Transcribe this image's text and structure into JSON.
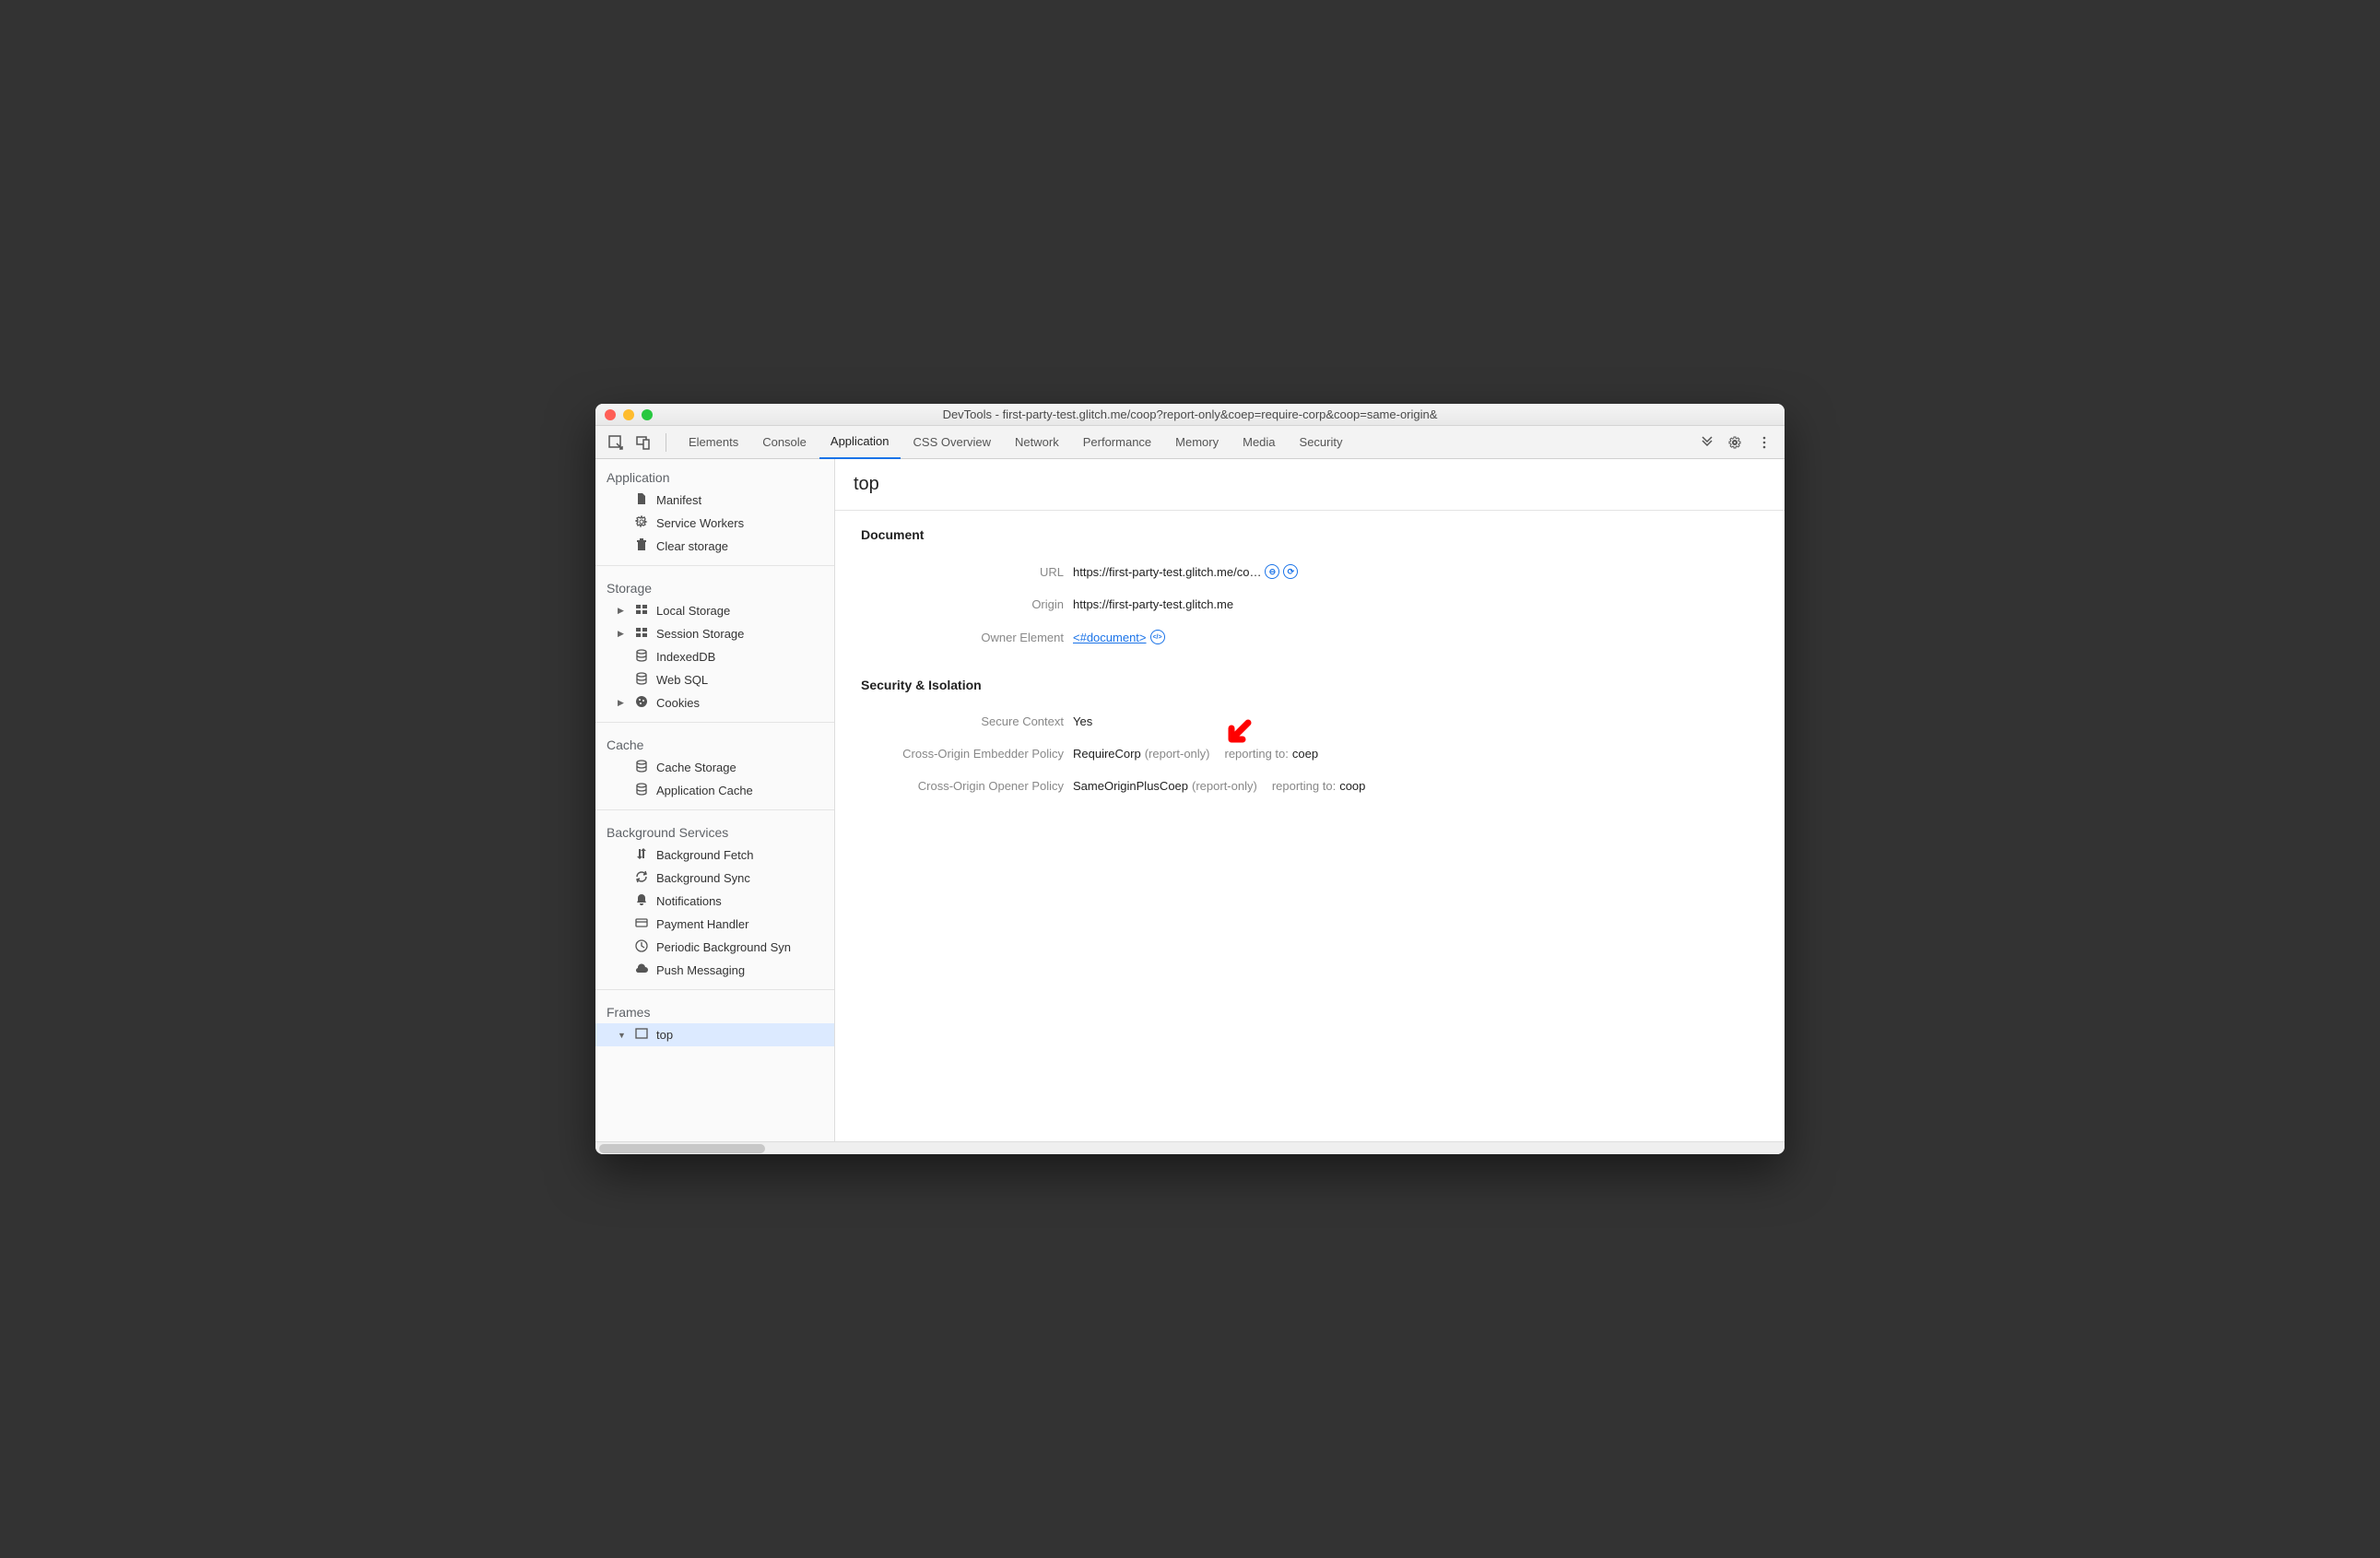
{
  "window": {
    "title": "DevTools - first-party-test.glitch.me/coop?report-only&coep=require-corp&coop=same-origin&"
  },
  "tabs": {
    "items": [
      "Elements",
      "Console",
      "Application",
      "CSS Overview",
      "Network",
      "Performance",
      "Memory",
      "Media",
      "Security"
    ],
    "active": "Application"
  },
  "sidebar": {
    "sections": [
      {
        "title": "Application",
        "items": [
          {
            "label": "Manifest",
            "icon": "file-icon"
          },
          {
            "label": "Service Workers",
            "icon": "gear-icon"
          },
          {
            "label": "Clear storage",
            "icon": "trash-icon"
          }
        ]
      },
      {
        "title": "Storage",
        "items": [
          {
            "label": "Local Storage",
            "icon": "grid-icon",
            "expandable": true
          },
          {
            "label": "Session Storage",
            "icon": "grid-icon",
            "expandable": true
          },
          {
            "label": "IndexedDB",
            "icon": "database-icon"
          },
          {
            "label": "Web SQL",
            "icon": "database-icon"
          },
          {
            "label": "Cookies",
            "icon": "cookie-icon",
            "expandable": true
          }
        ]
      },
      {
        "title": "Cache",
        "items": [
          {
            "label": "Cache Storage",
            "icon": "database-icon"
          },
          {
            "label": "Application Cache",
            "icon": "database-icon"
          }
        ]
      },
      {
        "title": "Background Services",
        "items": [
          {
            "label": "Background Fetch",
            "icon": "updown-icon"
          },
          {
            "label": "Background Sync",
            "icon": "sync-icon"
          },
          {
            "label": "Notifications",
            "icon": "bell-icon"
          },
          {
            "label": "Payment Handler",
            "icon": "card-icon"
          },
          {
            "label": "Periodic Background Syn",
            "icon": "clock-icon"
          },
          {
            "label": "Push Messaging",
            "icon": "cloud-icon"
          }
        ]
      },
      {
        "title": "Frames",
        "items": [
          {
            "label": "top",
            "icon": "frame-icon",
            "expandable": true,
            "selected": true
          }
        ]
      }
    ]
  },
  "main": {
    "title": "top",
    "groups": [
      {
        "title": "Document",
        "rows": [
          {
            "label": "URL",
            "value": "https://first-party-test.glitch.me/co…",
            "badges": [
              "minus",
              "reload"
            ]
          },
          {
            "label": "Origin",
            "value": "https://first-party-test.glitch.me"
          },
          {
            "label": "Owner Element",
            "link": "<#document>",
            "badgeLink": true
          }
        ]
      },
      {
        "title": "Security & Isolation",
        "rows": [
          {
            "label": "Secure Context",
            "value": "Yes"
          },
          {
            "label": "Cross-Origin Embedder Policy",
            "value": "RequireCorp",
            "extra": "(report-only)",
            "reporting_label": "reporting to:",
            "reporting_to": "coep",
            "arrow": true
          },
          {
            "label": "Cross-Origin Opener Policy",
            "value": "SameOriginPlusCoep",
            "extra": "(report-only)",
            "reporting_label": "reporting to:",
            "reporting_to": "coop"
          }
        ]
      }
    ]
  }
}
